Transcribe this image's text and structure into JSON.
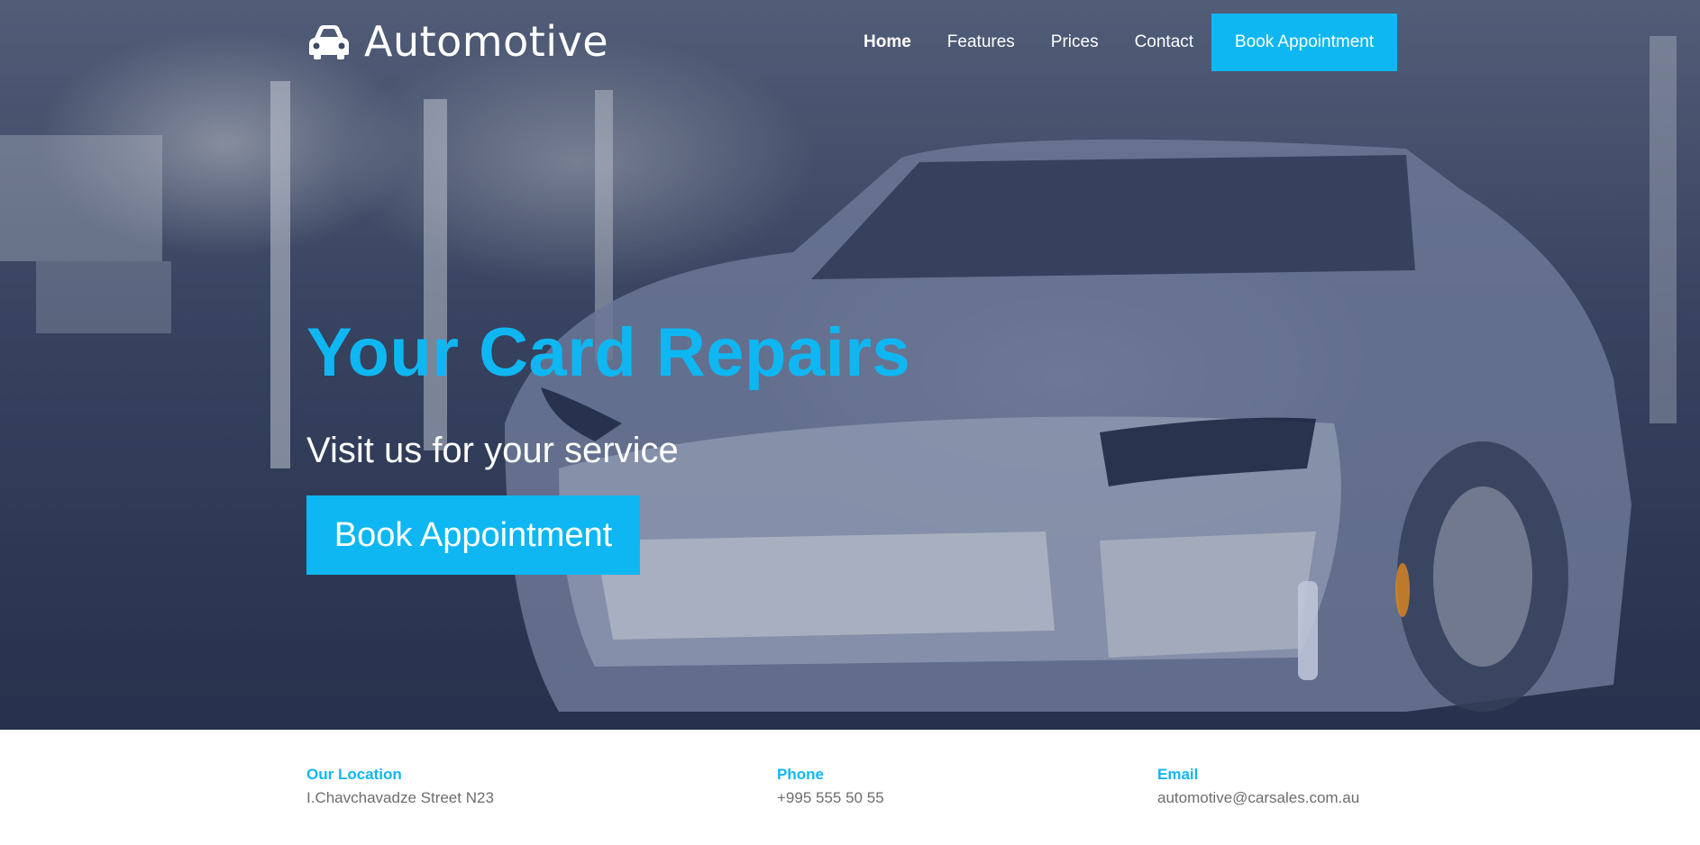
{
  "brand": {
    "name": "Automotive"
  },
  "nav": {
    "items": [
      {
        "label": "Home"
      },
      {
        "label": "Features"
      },
      {
        "label": "Prices"
      },
      {
        "label": "Contact"
      }
    ],
    "cta_label": "Book Appointment"
  },
  "hero": {
    "title": "Your Card Repairs",
    "subtitle": "Visit us for your service",
    "cta_label": "Book Appointment"
  },
  "info": {
    "location": {
      "label": "Our Location",
      "value": "I.Chavchavadze Street N23"
    },
    "phone": {
      "label": "Phone",
      "value": "+995 555 50 55"
    },
    "email": {
      "label": "Email",
      "value": "automotive@carsales.com.au"
    }
  },
  "colors": {
    "accent": "#0fb7f2",
    "text_muted": "#6d6d6d",
    "hero_dark": "#2a3552"
  },
  "icons": {
    "brand_icon": "car-icon"
  }
}
